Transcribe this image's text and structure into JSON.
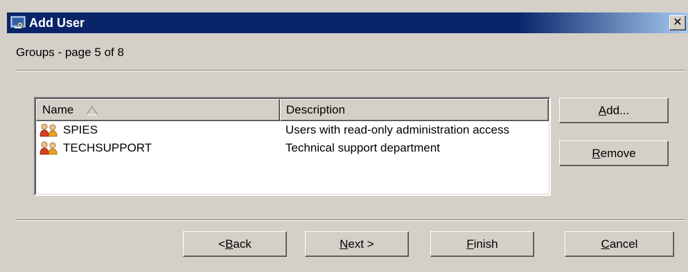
{
  "window": {
    "title": "Add User",
    "close_glyph": "✕"
  },
  "page": {
    "subtitle": "Groups - page 5 of 8"
  },
  "table": {
    "columns": [
      {
        "label": "Name",
        "sorted": "ascending"
      },
      {
        "label": "Description"
      }
    ],
    "rows": [
      {
        "name": "SPIES",
        "description": "Users with read-only administration access",
        "icon": "group-icon"
      },
      {
        "name": "TECHSUPPORT",
        "description": "Technical support department",
        "icon": "group-icon"
      }
    ]
  },
  "side_buttons": {
    "add": {
      "pre": "",
      "key": "A",
      "post": "dd..."
    },
    "remove": {
      "pre": "",
      "key": "R",
      "post": "emove"
    }
  },
  "footer_buttons": {
    "back": {
      "pre": "< ",
      "key": "B",
      "post": "ack"
    },
    "next": {
      "pre": "",
      "key": "N",
      "post": "ext >"
    },
    "finish": {
      "pre": "",
      "key": "F",
      "post": "inish"
    },
    "cancel": {
      "pre": "",
      "key": "C",
      "post": "ancel"
    }
  }
}
